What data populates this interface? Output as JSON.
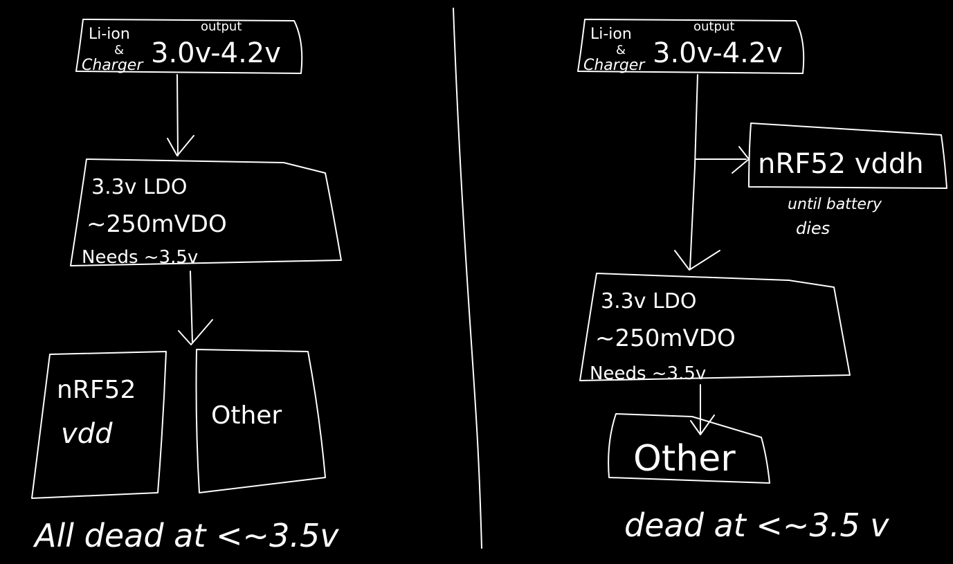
{
  "colors": {
    "background": "#000000",
    "ink": "#ffffff"
  },
  "left": {
    "charger": {
      "line1": "Li-ion",
      "line2": "&",
      "line3": "Charger",
      "output_label": "output",
      "voltage": "3.0v-4.2v"
    },
    "ldo": {
      "line1": "3.3v LDO",
      "line2": "~250mVDO",
      "line3": "Needs ~3.5v"
    },
    "load1": {
      "line1": "nRF52",
      "line2": "vdd"
    },
    "load2": {
      "line1": "Other"
    },
    "footer": "All dead at <~3.5v"
  },
  "right": {
    "charger": {
      "line1": "Li-ion",
      "line2": "&",
      "line3": "Charger",
      "output_label": "output",
      "voltage": "3.0v-4.2v"
    },
    "nrf": {
      "label": "nRF52 vddh",
      "note_line1": "until battery",
      "note_line2": "dies"
    },
    "ldo": {
      "line1": "3.3v LDO",
      "line2": "~250mVDO",
      "line3": "Needs ~3.5v"
    },
    "load": {
      "line1": "Other"
    },
    "footer": "dead at <~3.5 v"
  }
}
